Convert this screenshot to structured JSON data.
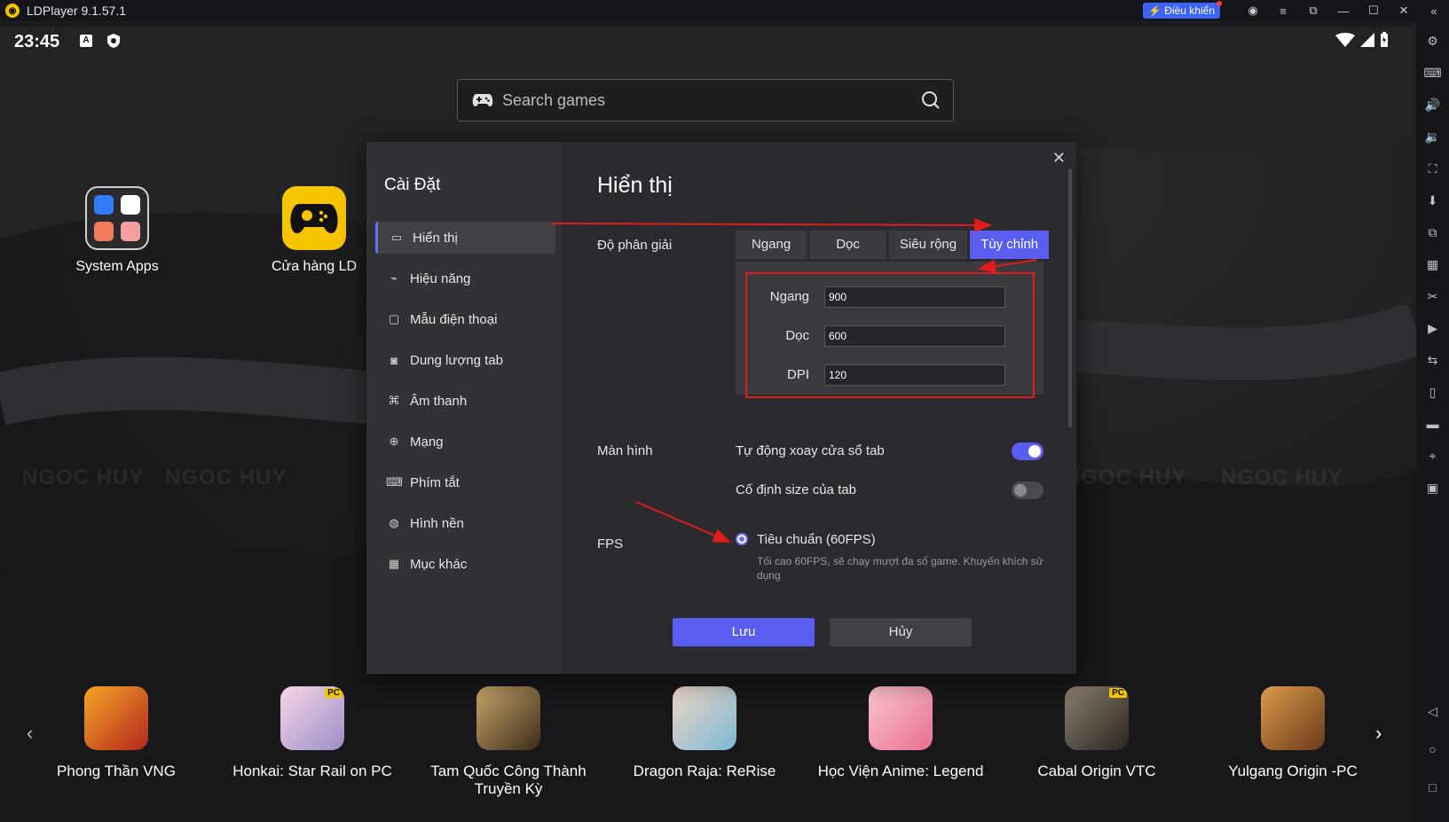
{
  "titlebar": {
    "app_name": "LDPlayer 9.1.57.1",
    "control_button": "Điều khiển"
  },
  "statusbar": {
    "time": "23:45"
  },
  "search": {
    "placeholder": "Search games"
  },
  "desktop_apps": [
    {
      "label": "System Apps"
    },
    {
      "label": "Cửa hàng LD"
    }
  ],
  "watermark": "NGOC HUY",
  "dialog": {
    "sidebar_title": "Cài Đặt",
    "menu": [
      {
        "label": "Hiển thị",
        "icon": "monitor-icon"
      },
      {
        "label": "Hiệu năng",
        "icon": "performance-icon"
      },
      {
        "label": "Mẫu điện thoại",
        "icon": "phone-model-icon"
      },
      {
        "label": "Dung lượng tab",
        "icon": "storage-icon"
      },
      {
        "label": "Âm thanh",
        "icon": "gamepad-icon"
      },
      {
        "label": "Mạng",
        "icon": "globe-icon"
      },
      {
        "label": "Phím tắt",
        "icon": "keyboard-icon"
      },
      {
        "label": "Hình nền",
        "icon": "palette-icon"
      },
      {
        "label": "Mục khác",
        "icon": "grid-icon"
      }
    ],
    "page_title": "Hiển thị",
    "resolution": {
      "label": "Độ phân giải",
      "tabs": [
        "Ngang",
        "Dọc",
        "Siêu rộng",
        "Tùy chỉnh"
      ],
      "selected_tab": "Tùy chỉnh",
      "width_label": "Ngang",
      "width_value": "900",
      "height_label": "Dọc",
      "height_value": "600",
      "dpi_label": "DPI",
      "dpi_value": "120"
    },
    "screen": {
      "label": "Màn hình",
      "auto_rotate": "Tự động xoay cửa sổ tab",
      "auto_rotate_on": true,
      "fixed_size": "Cố định size của tab",
      "fixed_size_on": false
    },
    "fps": {
      "label": "FPS",
      "option": "Tiêu chuẩn (60FPS)",
      "description": "Tối cao 60FPS, sẽ chạy mượt đa số game. Khuyến khích sử dụng"
    },
    "save": "Lưu",
    "cancel": "Hủy"
  },
  "bottom_apps": [
    {
      "label": "Phong Thần VNG"
    },
    {
      "label": "Honkai: Star Rail on PC"
    },
    {
      "label": "Tam Quốc Công Thành Truyền Kỳ"
    },
    {
      "label": "Dragon Raja: ReRise"
    },
    {
      "label": "Học Viện Anime: Legend"
    },
    {
      "label": "Cabal Origin VTC"
    },
    {
      "label": "Yulgang Origin -PC"
    }
  ],
  "colors": {
    "accent": "#5a5ef0",
    "annotation": "#e21b1b",
    "brand_yellow": "#f7c400"
  }
}
